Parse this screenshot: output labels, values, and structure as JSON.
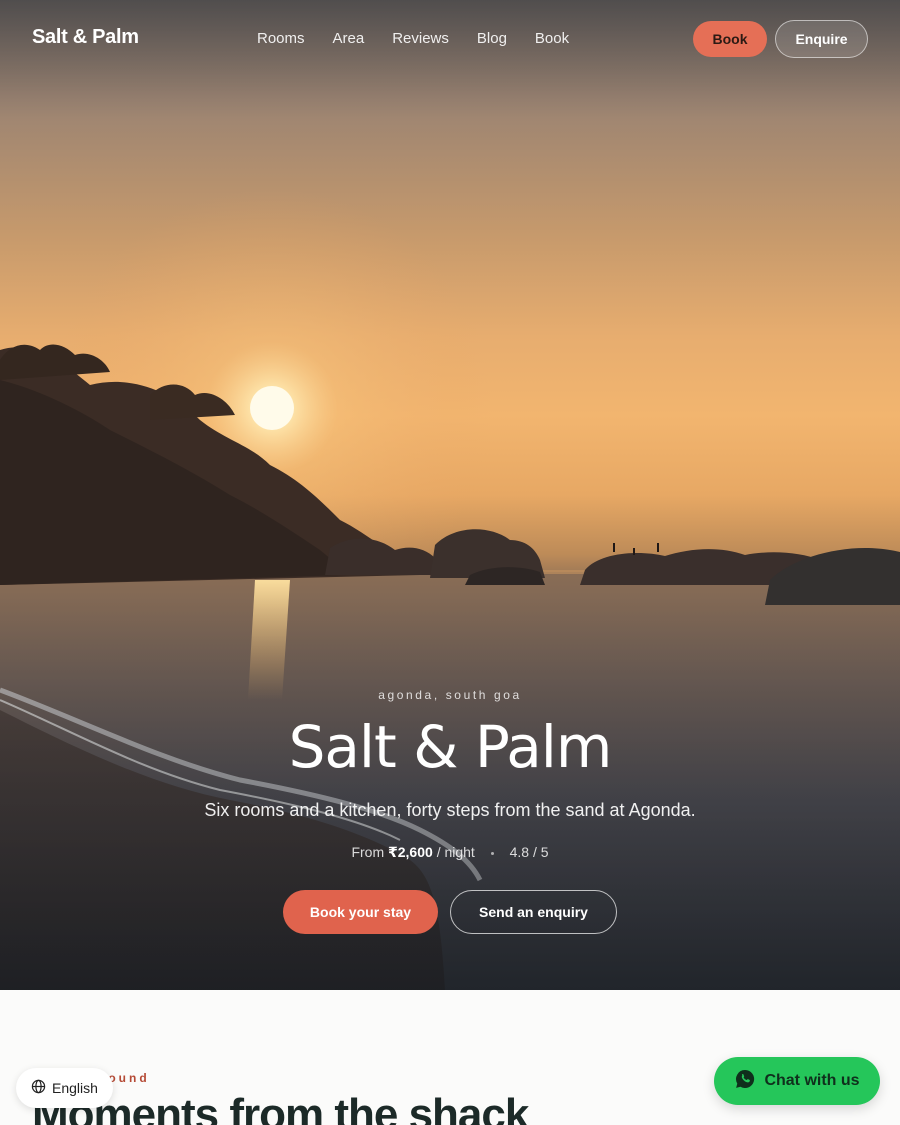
{
  "brand": "Salt & Palm",
  "nav": {
    "links": [
      "Rooms",
      "Area",
      "Reviews",
      "Blog",
      "Book"
    ],
    "book_button": "Book",
    "enquire_button": "Enquire"
  },
  "hero": {
    "eyebrow": "agonda, south goa",
    "title": "Salt & Palm",
    "subtitle": "Six rooms and a kitchen, forty steps from the sand at Agonda.",
    "price_prefix": "From",
    "price": "₹2,600",
    "price_suffix": "/ night",
    "rating": "4.8 / 5",
    "primary_cta": "Book your stay",
    "secondary_cta": "Send an enquiry"
  },
  "section": {
    "eyebrow": "a look around",
    "title": "Moments from the shack"
  },
  "language": {
    "icon": "globe-icon",
    "label": "English"
  },
  "chat": {
    "icon": "whatsapp-icon",
    "label": "Chat with us"
  },
  "colors": {
    "accent": "#e0634d",
    "chat_green": "#25c65a",
    "heading_dark": "#1c2a28"
  }
}
